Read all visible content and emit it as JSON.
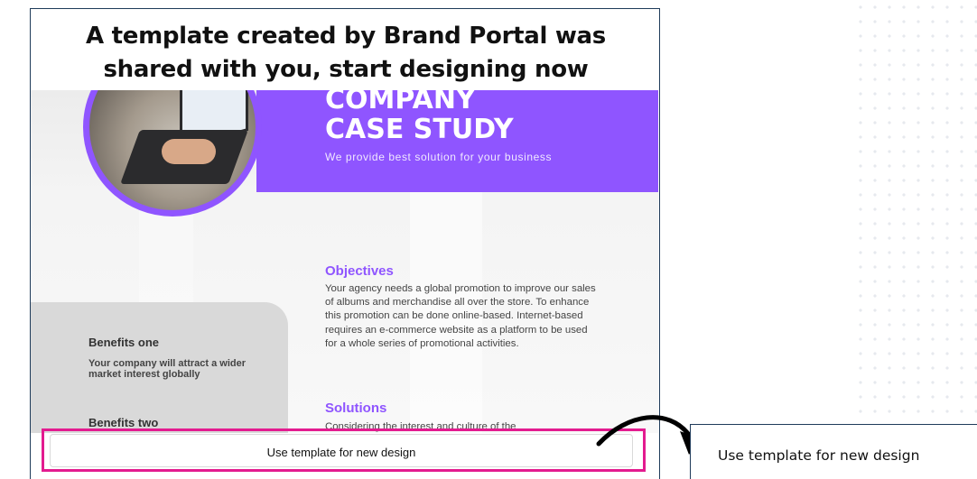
{
  "heading": {
    "line1": "A template created by Brand Portal was",
    "line2": "shared with you, start designing now"
  },
  "template": {
    "banner": {
      "title_line1": "COMPANY",
      "title_line2": "CASE STUDY",
      "subtitle": "We provide best solution for your business"
    },
    "benefits": [
      {
        "title": "Benefits one",
        "text": "Your company will attract a wider market interest globally"
      },
      {
        "title": "Benefits two",
        "text": ""
      }
    ],
    "objectives": {
      "title": "Objectives",
      "text": "Your agency needs a global promotion to improve our sales of albums and merchandise all over the store. To enhance this promotion can be done online-based. Internet-based requires an e-commerce website as a platform to be used for a whole series of promotional activities."
    },
    "solutions": {
      "title": "Solutions",
      "text": "Considering the interest and culture of the"
    }
  },
  "actions": {
    "use_template_label": "Use template for new design",
    "zoomed_label": "Use template for new design"
  },
  "colors": {
    "accent": "#8f55ff",
    "highlight": "#e31b8f",
    "frame": "#1f3b5a"
  }
}
